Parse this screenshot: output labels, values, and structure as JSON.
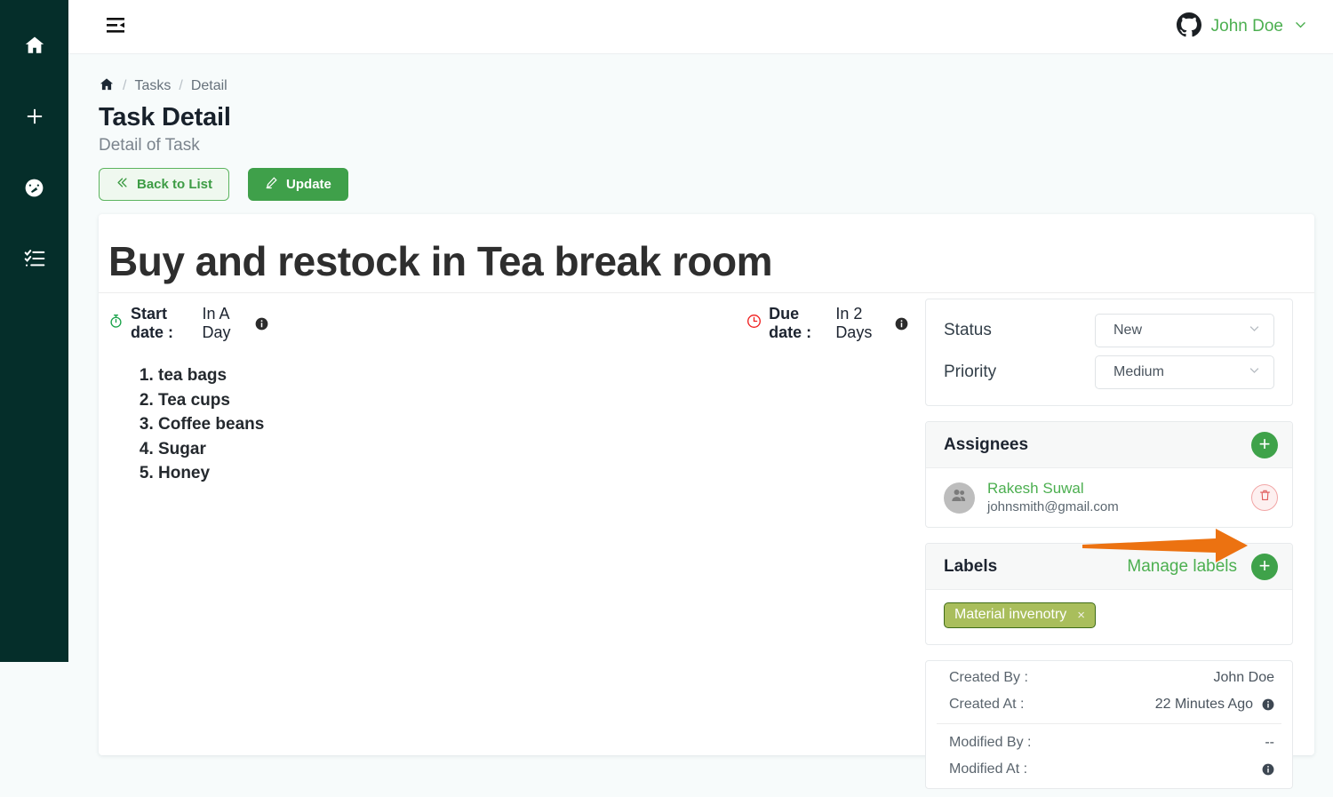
{
  "sidebar": {
    "items": [
      {
        "name": "home",
        "icon": "home-icon"
      },
      {
        "name": "add",
        "icon": "plus-icon"
      },
      {
        "name": "dashboard",
        "icon": "speedometer-icon"
      },
      {
        "name": "tasks",
        "icon": "checklist-icon"
      }
    ],
    "bg_color": "#052e2a"
  },
  "topbar": {
    "menu_icon": "menu-fold-icon",
    "account_icon": "github-icon",
    "user_name": "John Doe",
    "caret_icon": "chevron-down-icon"
  },
  "breadcrumb": {
    "home_icon": "home-icon",
    "items": [
      "Tasks",
      "Detail"
    ],
    "separator": "/"
  },
  "header": {
    "title": "Task Detail",
    "subtitle": "Detail of Task"
  },
  "actions": {
    "back_label": "Back to List",
    "back_icon": "double-chevron-left-icon",
    "update_label": "Update",
    "update_icon": "pencil-icon"
  },
  "task": {
    "title": "Buy and restock in Tea break room",
    "start_date_label": "Start date :",
    "start_date_value": "In A Day",
    "start_date_icon": "stopwatch-icon",
    "due_date_label": "Due date :",
    "due_date_value": "In 2 Days",
    "due_date_icon": "clock-icon",
    "description_items": [
      "tea bags",
      "Tea cups",
      "Coffee beans",
      "Sugar",
      "Honey"
    ]
  },
  "status_panel": {
    "status_label": "Status",
    "status_value": "New",
    "priority_label": "Priority",
    "priority_value": "Medium",
    "caret_icon": "chevron-down-icon"
  },
  "assignees": {
    "title": "Assignees",
    "add_icon": "plus-icon",
    "list": [
      {
        "name": "Rakesh Suwal",
        "email": "johnsmith@gmail.com",
        "avatar_icon": "users-icon",
        "delete_icon": "trash-icon"
      }
    ]
  },
  "labels": {
    "title": "Labels",
    "manage_link": "Manage labels",
    "add_icon": "plus-icon",
    "chips": [
      {
        "text": "Material invenotry",
        "remove_icon": "close-icon",
        "color": "#a9be5c"
      }
    ]
  },
  "meta": {
    "rows": [
      {
        "label": "Created By :",
        "value": "John Doe",
        "info": false
      },
      {
        "label": "Created At :",
        "value": "22 Minutes Ago",
        "info": true
      },
      {
        "label": "Modified By :",
        "value": "--",
        "info": false
      },
      {
        "label": "Modified At :",
        "value": "",
        "info": true
      }
    ]
  },
  "annotation": {
    "type": "arrow",
    "color": "#ec7211",
    "points_to": "labels-add-button"
  },
  "colors": {
    "brand_green": "#3fa24a",
    "link_green": "#4caf50",
    "sidebar": "#052e2a",
    "page_bg": "#f7fbfb",
    "danger": "#e05c5c",
    "annotation_orange": "#ec7211"
  }
}
